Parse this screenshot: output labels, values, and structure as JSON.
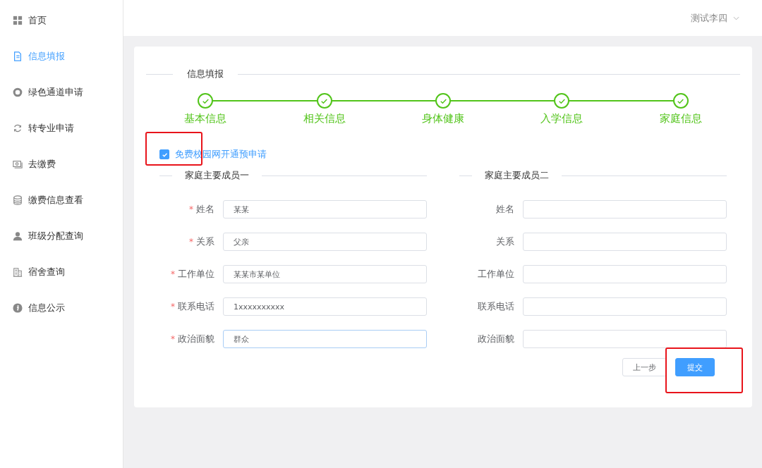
{
  "sidebar": {
    "items": [
      {
        "label": "首页",
        "selected": false
      },
      {
        "label": "信息填报",
        "selected": true
      },
      {
        "label": "绿色通道申请",
        "selected": false
      },
      {
        "label": "转专业申请",
        "selected": false
      },
      {
        "label": "去缴费",
        "selected": false
      },
      {
        "label": "缴费信息查看",
        "selected": false
      },
      {
        "label": "班级分配查询",
        "selected": false
      },
      {
        "label": "宿舍查询",
        "selected": false
      },
      {
        "label": "信息公示",
        "selected": false
      }
    ]
  },
  "header": {
    "user": "测试李四"
  },
  "form": {
    "title": "信息填报",
    "steps": [
      {
        "label": "基本信息",
        "completed": true
      },
      {
        "label": "相关信息",
        "completed": true
      },
      {
        "label": "身体健康",
        "completed": true
      },
      {
        "label": "入学信息",
        "completed": true
      },
      {
        "label": "家庭信息",
        "completed": true
      }
    ],
    "checkbox": {
      "label": "免费校园网开通预申请",
      "checked": true,
      "highlighted": true
    },
    "members": [
      {
        "title": "家庭主要成员一",
        "fields": [
          {
            "label": "姓名",
            "required_mark": "*",
            "value": "某某",
            "focused": false
          },
          {
            "label": "关系",
            "required_mark": "*",
            "value": "父亲",
            "focused": false
          },
          {
            "label": "工作单位",
            "required_mark": "*",
            "value": "某某市某单位",
            "focused": false
          },
          {
            "label": "联系电话",
            "required_mark": "*",
            "value": "1xxxxxxxxxx",
            "focused": false
          },
          {
            "label": "政治面貌",
            "required_mark": "*",
            "value": "群众",
            "focused": true
          }
        ]
      },
      {
        "title": "家庭主要成员二",
        "fields": [
          {
            "label": "姓名",
            "focused": false
          },
          {
            "label": "关系",
            "focused": false
          },
          {
            "label": "工作单位",
            "focused": false
          },
          {
            "label": "联系电话",
            "focused": false
          },
          {
            "label": "政治面貌",
            "focused": false
          }
        ]
      }
    ],
    "buttons": [
      {
        "label": "上一步",
        "kind": "default"
      },
      {
        "label": "提交",
        "kind": "primary",
        "highlighted": true
      }
    ]
  }
}
